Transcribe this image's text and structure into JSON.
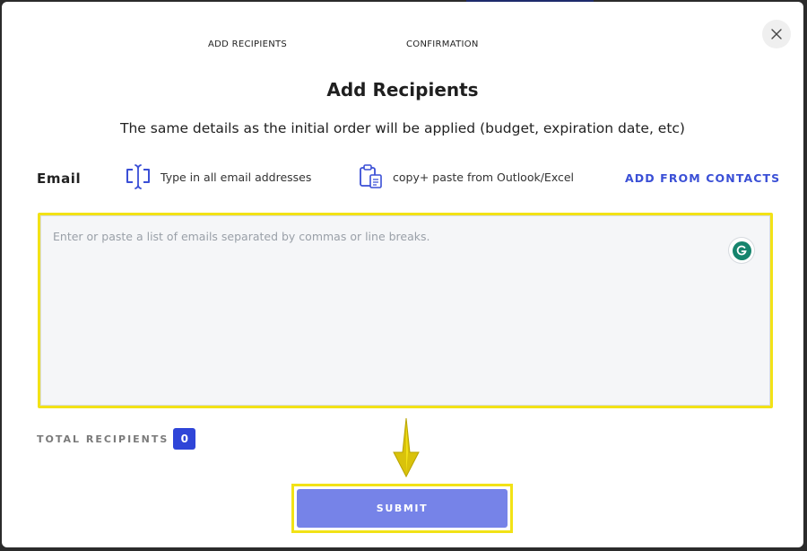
{
  "steps": [
    "ADD RECIPIENTS",
    "CONFIRMATION"
  ],
  "modal": {
    "title": "Add Recipients",
    "subtitle": "The same details as the initial order will be applied (budget, expiration date, etc)"
  },
  "email": {
    "label": "Email",
    "method_type": "Type in all email addresses",
    "method_paste": "copy+ paste from Outlook/Excel",
    "add_from_contacts": "ADD FROM CONTACTS",
    "placeholder": "Enter or paste a list of emails separated by commas or line breaks."
  },
  "total": {
    "label": "TOTAL RECIPIENTS",
    "count": "0"
  },
  "submit_label": "SUBMIT",
  "colors": {
    "accent": "#3a4fd6",
    "submit_bg": "#7683e8",
    "highlight": "#f2e216",
    "badge_bg": "#2f45d8",
    "grammarly": "#15846d"
  },
  "icons": {
    "close": "close-icon",
    "type": "text-cursor-icon",
    "paste": "clipboard-icon",
    "grammarly": "grammarly-icon",
    "arrow": "arrow-down-icon"
  }
}
